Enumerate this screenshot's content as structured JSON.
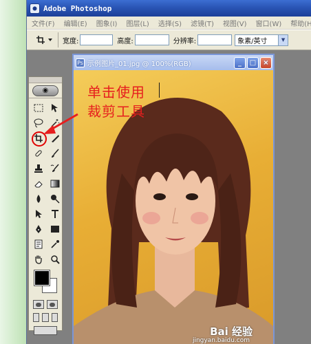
{
  "app": {
    "title": "Adobe Photoshop",
    "icon": "photoshop-eye-icon"
  },
  "menu": [
    "文件(F)",
    "编辑(E)",
    "图象(I)",
    "图层(L)",
    "选择(S)",
    "滤镜(T)",
    "视图(V)",
    "窗口(W)",
    "帮助(H)"
  ],
  "options": {
    "tool_icon": "crop-icon",
    "width_label": "宽度:",
    "width_value": "",
    "height_label": "高度:",
    "height_value": "",
    "resolution_label": "分辨率:",
    "resolution_value": "",
    "units_selected": "象素/英寸"
  },
  "document": {
    "title": "示例图片_01.jpg @ 100%(RGB)",
    "buttons": [
      "_",
      "□",
      "×"
    ]
  },
  "annotation": {
    "line1": "单击使用",
    "line2": "裁剪工具",
    "color": "#e61e1e"
  },
  "toolbox": {
    "tools": [
      "marquee-icon",
      "move-icon",
      "lasso-icon",
      "magic-wand-icon",
      "crop-icon",
      "slice-icon",
      "healing-brush-icon",
      "brush-icon",
      "clone-stamp-icon",
      "history-brush-icon",
      "eraser-icon",
      "gradient-icon",
      "blur-icon",
      "dodge-icon",
      "path-selection-icon",
      "type-icon",
      "pen-icon",
      "rectangle-icon",
      "notes-icon",
      "eyedropper-icon",
      "hand-icon",
      "zoom-icon"
    ],
    "highlighted_tool": "crop-icon",
    "foreground_color": "#000000",
    "background_color": "#ffffff"
  },
  "watermark": {
    "brand": "Bai 经验",
    "url": "jingyan.baidu.com"
  }
}
